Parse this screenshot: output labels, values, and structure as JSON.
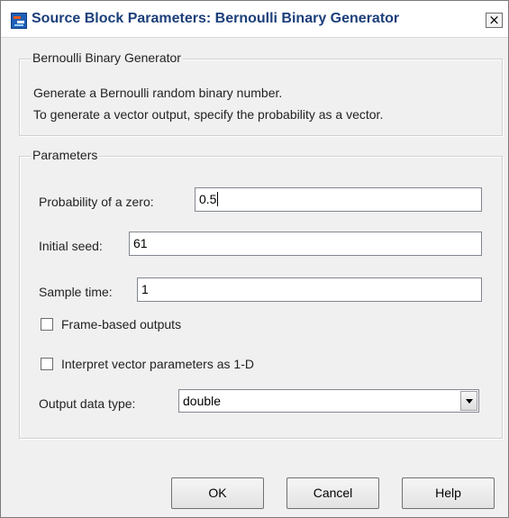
{
  "window": {
    "title": "Source Block Parameters: Bernoulli Binary Generator",
    "close_label": "×"
  },
  "description_group": {
    "legend": "Bernoulli Binary Generator",
    "lines": [
      "Generate a Bernoulli random binary number.",
      "To generate a vector output, specify the probability as a vector."
    ]
  },
  "parameters_group": {
    "legend": "Parameters",
    "probability": {
      "label": "Probability of a zero:",
      "value": "0.5"
    },
    "seed": {
      "label": "Initial seed:",
      "value": "61"
    },
    "sample_time": {
      "label": "Sample time:",
      "value": "1"
    },
    "frame_based": {
      "label": "Frame-based outputs",
      "checked": false
    },
    "interpret_1d": {
      "label": "Interpret vector parameters as 1-D",
      "checked": false
    },
    "output_type": {
      "label": "Output data type:",
      "selected": "double"
    }
  },
  "buttons": {
    "ok": "OK",
    "cancel": "Cancel",
    "help": "Help"
  }
}
